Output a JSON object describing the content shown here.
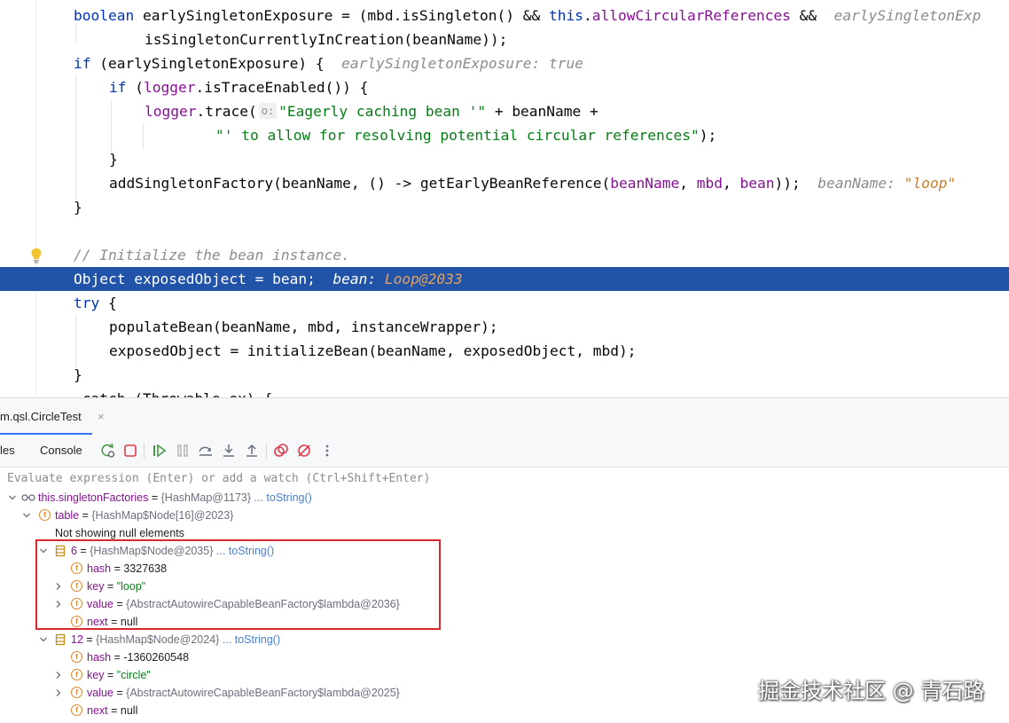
{
  "editor": {
    "lines": [
      [
        {
          "t": "boolean",
          "c": "kw"
        },
        {
          "t": " earlySingletonExposure = (mbd.isSingleton() && "
        },
        {
          "t": "this",
          "c": "kw"
        },
        {
          "t": "."
        },
        {
          "t": "allowCircularReferences",
          "c": "fld"
        },
        {
          "t": " &&  "
        },
        {
          "t": "earlySingletonExp",
          "c": "hint"
        }
      ],
      [
        {
          "t": "isSingletonCurrentlyInCreation(beanName));"
        }
      ],
      [
        {
          "t": "if",
          "c": "kw"
        },
        {
          "t": " (earlySingletonExposure) {  "
        },
        {
          "t": "earlySingletonExposure: true",
          "c": "hint"
        }
      ],
      [
        {
          "t": "if",
          "c": "kw"
        },
        {
          "t": " ("
        },
        {
          "t": "logger",
          "c": "fld"
        },
        {
          "t": ".isTraceEnabled()) {"
        }
      ],
      [
        {
          "t": "logger",
          "c": "fld"
        },
        {
          "t": ".trace("
        },
        {
          "t": "o:",
          "c": "param"
        },
        {
          "t": "\"Eagerly caching bean '\"",
          "c": "str"
        },
        {
          "t": " + beanName +"
        }
      ],
      [
        {
          "t": "\"' to allow for resolving potential circular references\"",
          "c": "str"
        },
        {
          "t": ");"
        }
      ],
      [
        {
          "t": "}"
        }
      ],
      [
        {
          "t": "addSingletonFactory(beanName, () -> getEarlyBeanReference("
        },
        {
          "t": "beanName",
          "c": "fld"
        },
        {
          "t": ", "
        },
        {
          "t": "mbd",
          "c": "fld"
        },
        {
          "t": ", "
        },
        {
          "t": "bean",
          "c": "fld"
        },
        {
          "t": "));  "
        },
        {
          "t": "beanName: ",
          "c": "hint"
        },
        {
          "t": "\"loop\"",
          "c": "hintval"
        }
      ],
      [
        {
          "t": "}"
        }
      ],
      [],
      [
        {
          "t": "// Initialize the bean instance.",
          "c": "cmt"
        }
      ],
      [
        {
          "t": "Object exposedObject = bean;  "
        },
        {
          "t": "bean: ",
          "c": "hint"
        },
        {
          "t": "Loop@2033",
          "c": "hintval"
        }
      ],
      [
        {
          "t": "try",
          "c": "kw"
        },
        {
          "t": " {"
        }
      ],
      [
        {
          "t": "populateBean(beanName, mbd, instanceWrapper);"
        }
      ],
      [
        {
          "t": "exposedObject = initializeBean(beanName, exposedObject, mbd);"
        }
      ],
      [
        {
          "t": "}"
        }
      ],
      [
        {
          "t": " catch (Throwable ex) {"
        }
      ]
    ]
  },
  "debug": {
    "session_tab": "m.qsl.CircleTest",
    "session_close": "×",
    "tab_variables": "les",
    "tab_console": "Console",
    "eval_placeholder": "Evaluate expression (Enter) or add a watch (Ctrl+Shift+Enter)"
  },
  "variables": [
    {
      "name": "this.singletonFactories",
      "type": "{HashMap@1173}",
      "link": "... toString()",
      "icon": "watch"
    },
    {
      "name": "table",
      "type": "{HashMap$Node[16]@2023}",
      "icon": "field"
    },
    {
      "plain": "Not showing null elements"
    },
    {
      "name": "6",
      "type": "{HashMap$Node@2035}",
      "link": "... toString()",
      "icon": "array"
    },
    {
      "name": "hash",
      "value": "3327638",
      "icon": "field"
    },
    {
      "name": "key",
      "value": "\"loop\"",
      "icon": "field"
    },
    {
      "name": "value",
      "type": "{AbstractAutowireCapableBeanFactory$lambda@2036}",
      "icon": "field"
    },
    {
      "name": "next",
      "value": "null",
      "icon": "field"
    },
    {
      "name": "12",
      "type": "{HashMap$Node@2024}",
      "link": "... toString()",
      "icon": "array"
    },
    {
      "name": "hash",
      "value": "-1360260548",
      "icon": "field"
    },
    {
      "name": "key",
      "value": "\"circle\"",
      "icon": "field"
    },
    {
      "name": "value",
      "type": "{AbstractAutowireCapableBeanFactory$lambda@2025}",
      "icon": "field"
    },
    {
      "name": "next",
      "value": "null",
      "icon": "field"
    }
  ],
  "watermark": "掘金技术社区 @ 青石路",
  "colors": {
    "current_line": "#2154a8",
    "highlight_box": "#d9272e",
    "keyword": "#0033b3",
    "field": "#871094",
    "string": "#067d17"
  }
}
